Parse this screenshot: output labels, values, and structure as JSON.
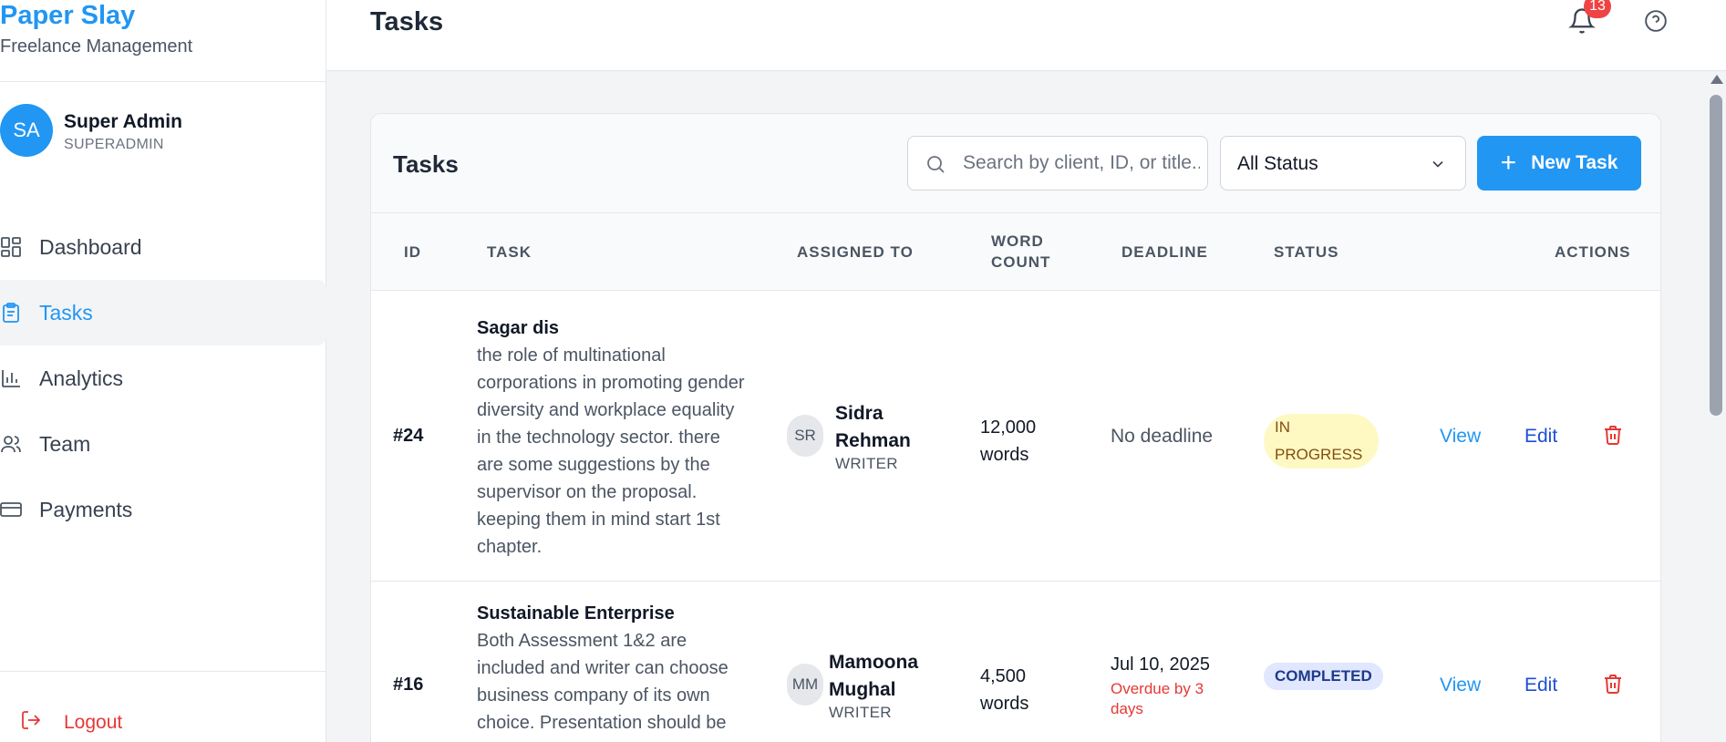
{
  "brand": {
    "name": "Paper Slay",
    "subtitle": "Freelance Management"
  },
  "user": {
    "initials": "SA",
    "name": "Super Admin",
    "role": "SUPERADMIN"
  },
  "sidebar": {
    "items": [
      {
        "label": "Dashboard",
        "icon": "dashboard-icon",
        "active": false
      },
      {
        "label": "Tasks",
        "icon": "clipboard-icon",
        "active": true
      },
      {
        "label": "Analytics",
        "icon": "bar-chart-icon",
        "active": false
      },
      {
        "label": "Team",
        "icon": "users-icon",
        "active": false
      },
      {
        "label": "Payments",
        "icon": "credit-card-icon",
        "active": false
      }
    ],
    "logout_label": "Logout"
  },
  "header": {
    "title": "Tasks",
    "notification_count": "13"
  },
  "card": {
    "title": "Tasks",
    "search_placeholder": "Search by client, ID, or title...",
    "status_filter": "All Status",
    "new_task_label": "New Task"
  },
  "table": {
    "columns": [
      "ID",
      "TASK",
      "ASSIGNED TO",
      "WORD COUNT",
      "DEADLINE",
      "STATUS",
      "ACTIONS"
    ],
    "rows": [
      {
        "id": "#24",
        "title": "Sagar dis",
        "description": "the role of multinational corporations in promoting gender diversity and workplace equality in the technology sector. there are some suggestions by the supervisor on the proposal. keeping them in mind start 1st chapter.",
        "assignee_initials": "SR",
        "assignee_name": "Sidra Rehman",
        "assignee_role": "WRITER",
        "word_count": "12,000 words",
        "deadline": "No deadline",
        "deadline_note": "",
        "status": "IN PROGRESS",
        "view_label": "View",
        "edit_label": "Edit"
      },
      {
        "id": "#16",
        "title": "Sustainable Enterprise",
        "description": "Both Assessment 1&2 are included and writer can choose business company of its own choice. Presentation should be",
        "assignee_initials": "MM",
        "assignee_name": "Mamoona Mughal",
        "assignee_role": "WRITER",
        "word_count": "4,500 words",
        "deadline": "Jul 10, 2025",
        "deadline_note": "Overdue by 3 days",
        "status": "COMPLETED",
        "view_label": "View",
        "edit_label": "Edit"
      }
    ]
  },
  "colors": {
    "accent": "#2196f3",
    "danger": "#e53935",
    "in_progress_bg": "#fef9c3",
    "completed_bg": "#e0e7ff"
  }
}
